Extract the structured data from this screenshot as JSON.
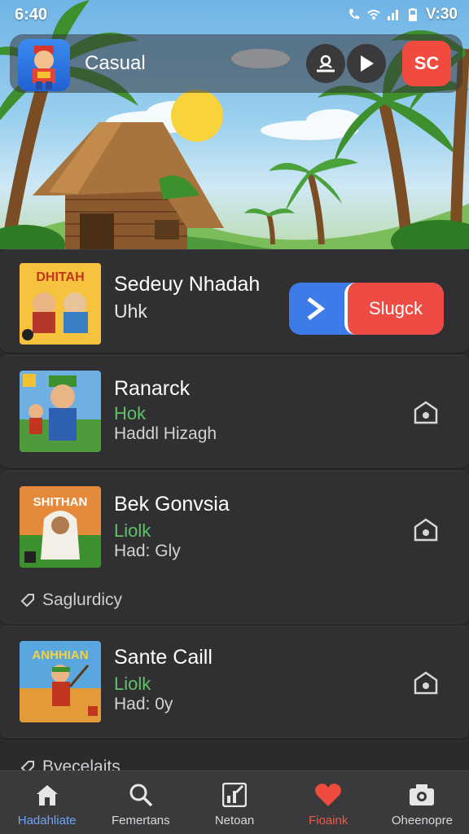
{
  "status_bar": {
    "time": "6:40",
    "right_text": "V:30"
  },
  "app_bar": {
    "title": "Casual",
    "badge_text": "SC"
  },
  "featured": {
    "thumb_text": "DHITAH",
    "name": "Sedeuy Nhadah",
    "subtitle": "Uhk",
    "action_label": "Slugck"
  },
  "items": [
    {
      "name": "Ranarck",
      "status": "Hok",
      "detail": "Haddl Hizagh"
    },
    {
      "name": "Bek Gonvsia",
      "status": "Liolk",
      "detail": "Had: Gly",
      "thumb_text": "SHITHAN"
    },
    {
      "name": "Sante Caill",
      "status": "Liolk",
      "detail": "Had: 0y",
      "thumb_text": "ANHHIAN"
    }
  ],
  "sections": {
    "first": "Saglurdicy",
    "second": "Byecelaits"
  },
  "nav": [
    {
      "label": "Hadahliate",
      "icon": "home-icon"
    },
    {
      "label": "Femertans",
      "icon": "search-icon"
    },
    {
      "label": "Netoan",
      "icon": "chart-icon"
    },
    {
      "label": "Fioaink",
      "icon": "heart-icon"
    },
    {
      "label": "Oheenopre",
      "icon": "camera-icon"
    }
  ],
  "colors": {
    "accent_blue": "#3d7be8",
    "accent_red": "#ee4b45",
    "status_green": "#5fc16a"
  }
}
